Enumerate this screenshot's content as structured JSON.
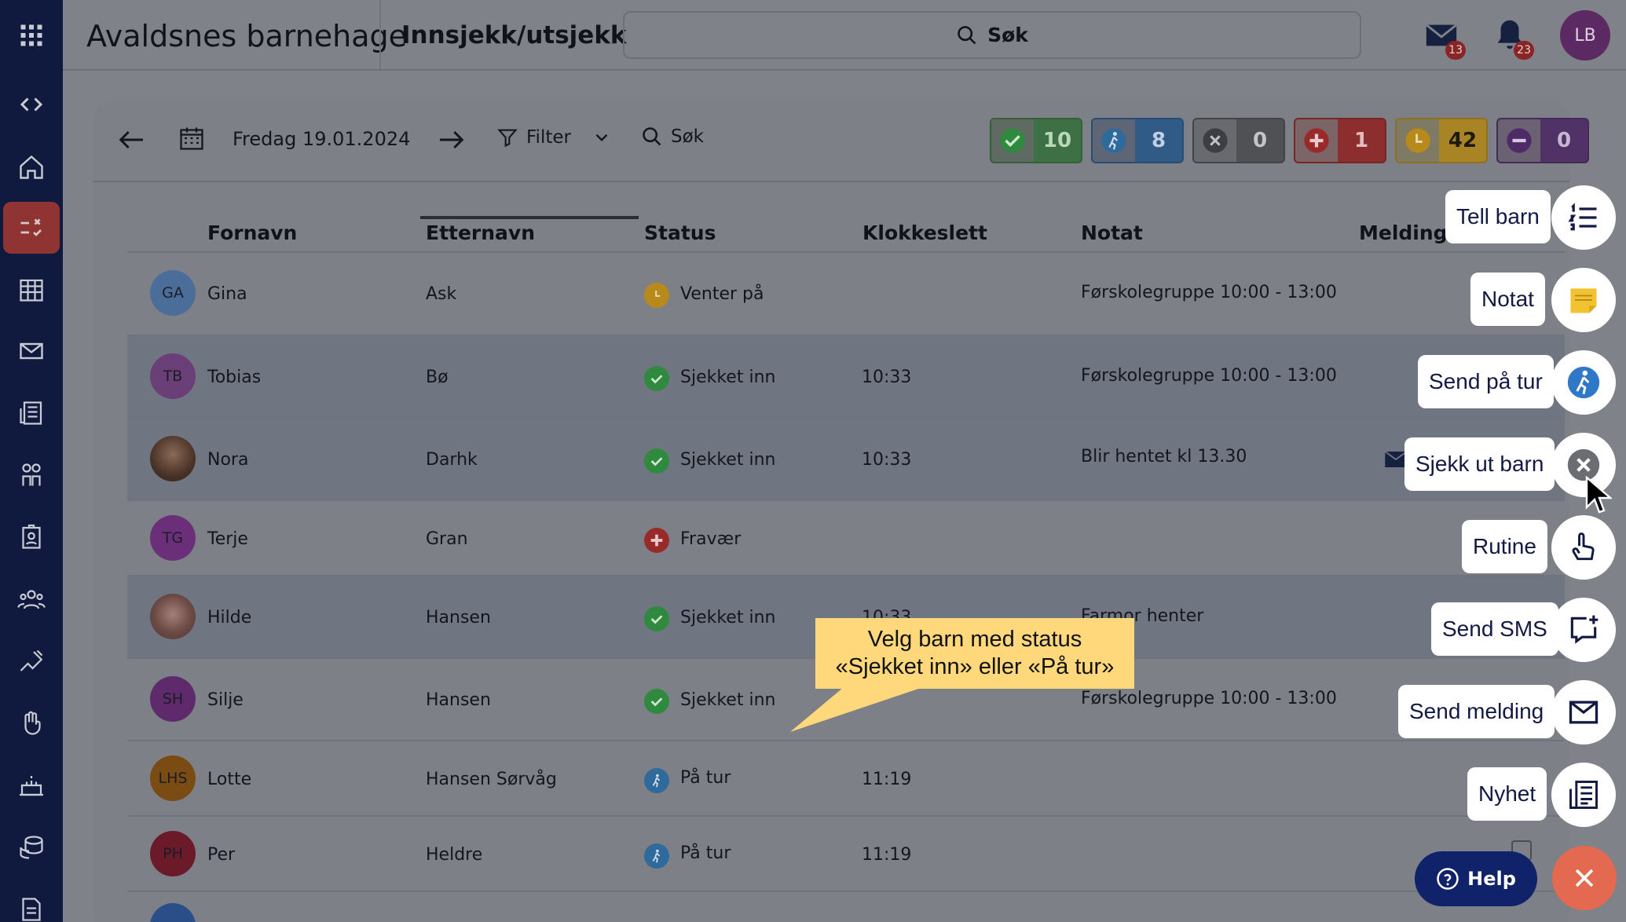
{
  "app": {
    "title": "Avaldsnes barnehage",
    "page_title": "Innsjekk/utsjekk"
  },
  "topbar": {
    "search_label": "Søk",
    "mail_badge": "13",
    "bell_badge": "23",
    "user_initials": "LB"
  },
  "toolbar": {
    "date": "Fredag 19.01.2024",
    "filter_label": "Filter",
    "search_label": "Søk"
  },
  "stats": [
    {
      "icon": "check-icon",
      "value": "10",
      "color": "#2f8a3f"
    },
    {
      "icon": "walking-icon",
      "value": "8",
      "color": "#2f6a9c"
    },
    {
      "icon": "x-circle-icon",
      "value": "0",
      "color": "#4a4c50"
    },
    {
      "icon": "plus-cross-icon",
      "value": "1",
      "color": "#9a2a2a"
    },
    {
      "icon": "clock-icon",
      "value": "42",
      "color": "#b88a1c"
    },
    {
      "icon": "minus-circle-icon",
      "value": "0",
      "color": "#4e2b66"
    }
  ],
  "columns": [
    "Fornavn",
    "Etternavn",
    "Status",
    "Klokkeslett",
    "Notat",
    "Meldinger"
  ],
  "rows": [
    {
      "initials": "GA",
      "first": "Gina",
      "last": "Ask",
      "status": "Venter på",
      "time": "",
      "note": "Førskolegruppe 10:00 - 13:00"
    },
    {
      "initials": "TB",
      "first": "Tobias",
      "last": "Bø",
      "status": "Sjekket inn",
      "time": "10:33",
      "note": "Førskolegruppe 10:00 - 13:00"
    },
    {
      "initials": "",
      "first": "Nora",
      "last": "Darhk",
      "status": "Sjekket inn",
      "time": "10:33",
      "note": "Blir hentet kl 13.30"
    },
    {
      "initials": "TG",
      "first": "Terje",
      "last": "Gran",
      "status": "Fravær",
      "time": "",
      "note": ""
    },
    {
      "initials": "",
      "first": "Hilde",
      "last": "Hansen",
      "status": "Sjekket inn",
      "time": "10:33",
      "note": "Farmor henter"
    },
    {
      "initials": "SH",
      "first": "Silje",
      "last": "Hansen",
      "status": "Sjekket inn",
      "time": "",
      "note": "Førskolegruppe 10:00 - 13:00"
    },
    {
      "initials": "LHS",
      "first": "Lotte",
      "last": "Hansen Sørvåg",
      "status": "På tur",
      "time": "11:19",
      "note": ""
    },
    {
      "initials": "PH",
      "first": "Per",
      "last": "Heldre",
      "status": "På tur",
      "time": "11:19",
      "note": ""
    }
  ],
  "fab_menu": [
    "Tell barn",
    "Notat",
    "Send på tur",
    "Sjekk ut barn",
    "Rutine",
    "Send SMS",
    "Send melding",
    "Nyhet"
  ],
  "tooltip": {
    "line1": "Velg barn med status",
    "line2": "«Sjekket inn» eller «På tur»"
  },
  "help": {
    "label": "Help"
  }
}
